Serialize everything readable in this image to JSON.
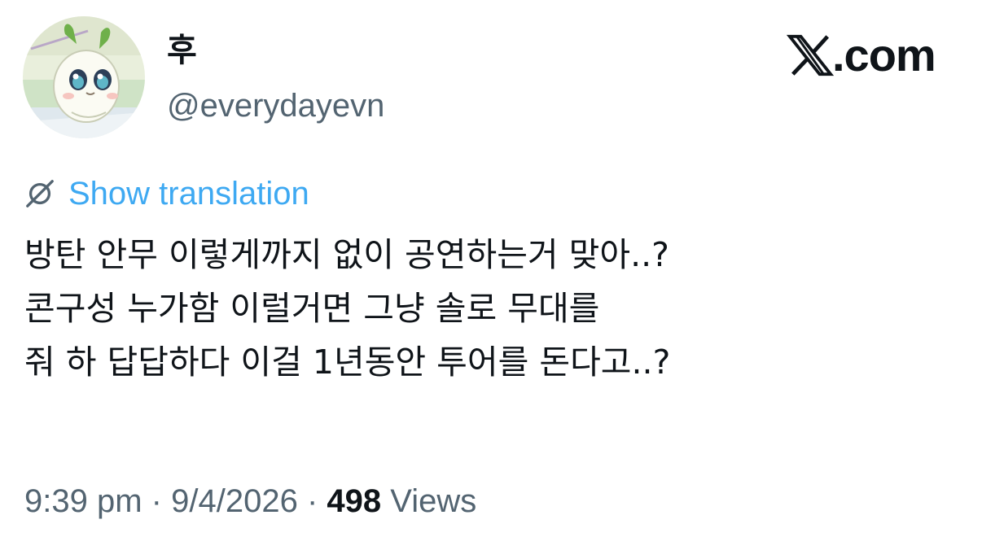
{
  "author": {
    "display_name": "후",
    "handle": "@everydayevn",
    "avatar_icon": "cartoon-leek-character-avatar"
  },
  "brand": {
    "text": ".com",
    "icon": "x-logo-icon"
  },
  "translation": {
    "icon": "globe-translate-icon",
    "label": "Show translation",
    "color": "#1d9bf0"
  },
  "tweet": {
    "lines": [
      "방탄 안무 이렇게까지 없이 공연하는거 맞아..?",
      "콘구성 누가함 이럴거면 그냥 솔로 무대를",
      "줘 하 답답하다 이걸 1년동안 투어를 돈다고..?"
    ]
  },
  "meta": {
    "time": "9:39 pm",
    "separator": "·",
    "date": "9/4/2026",
    "views_count": "498",
    "views_label": "Views"
  },
  "colors": {
    "text_primary": "#0f1419",
    "text_secondary": "#536471",
    "background": "#ffffff"
  }
}
